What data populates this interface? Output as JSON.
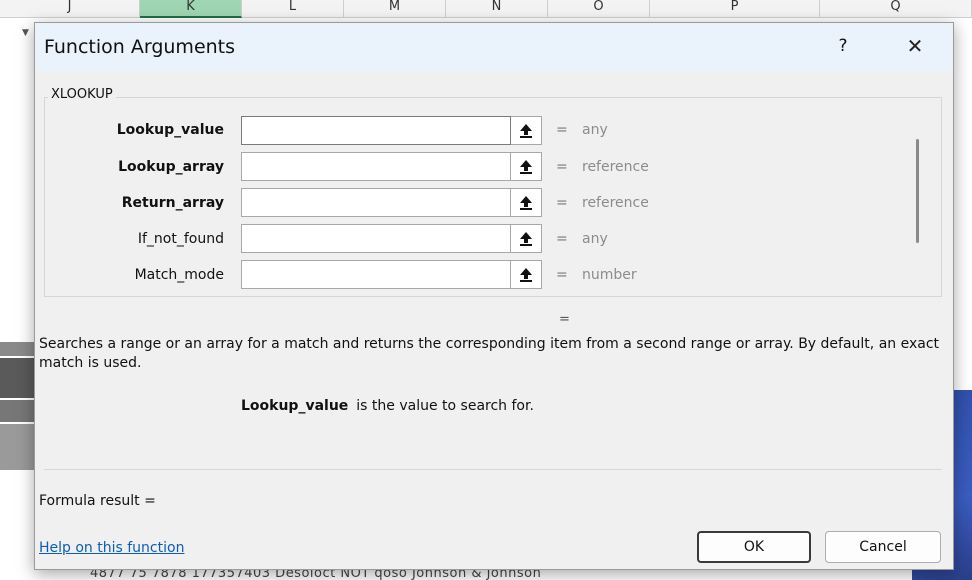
{
  "spreadsheet": {
    "columns": [
      "J",
      "K",
      "L",
      "M",
      "N",
      "O",
      "P",
      "Q"
    ],
    "selected_column": "K",
    "bottom_row_text": "4877  75  7878          177357403 Desoloct  NOT  qoso Johnson & Johnson"
  },
  "dialog": {
    "title": "Function Arguments",
    "help_glyph": "?",
    "close_glyph": "✕",
    "function_name": "XLOOKUP",
    "arguments": [
      {
        "label": "Lookup_value",
        "bold": true,
        "value": "",
        "eq": "=",
        "type": "any"
      },
      {
        "label": "Lookup_array",
        "bold": true,
        "value": "",
        "eq": "=",
        "type": "reference"
      },
      {
        "label": "Return_array",
        "bold": true,
        "value": "",
        "eq": "=",
        "type": "reference"
      },
      {
        "label": "If_not_found",
        "bold": false,
        "value": "",
        "eq": "=",
        "type": "any"
      },
      {
        "label": "Match_mode",
        "bold": false,
        "value": "",
        "eq": "=",
        "type": "number"
      }
    ],
    "result_eq": "=",
    "description": "Searches a range or an array for a match and returns the corresponding item from a second range or array. By default, an exact match is used.",
    "arg_help_name": "Lookup_value",
    "arg_help_text": "is the value to search for.",
    "formula_result_label": "Formula result =",
    "help_link": "Help on this function",
    "ok_label": "OK",
    "cancel_label": "Cancel"
  },
  "icons": {
    "collapse": "collapse-dialog-icon",
    "filter": "filter-dropdown-icon"
  }
}
